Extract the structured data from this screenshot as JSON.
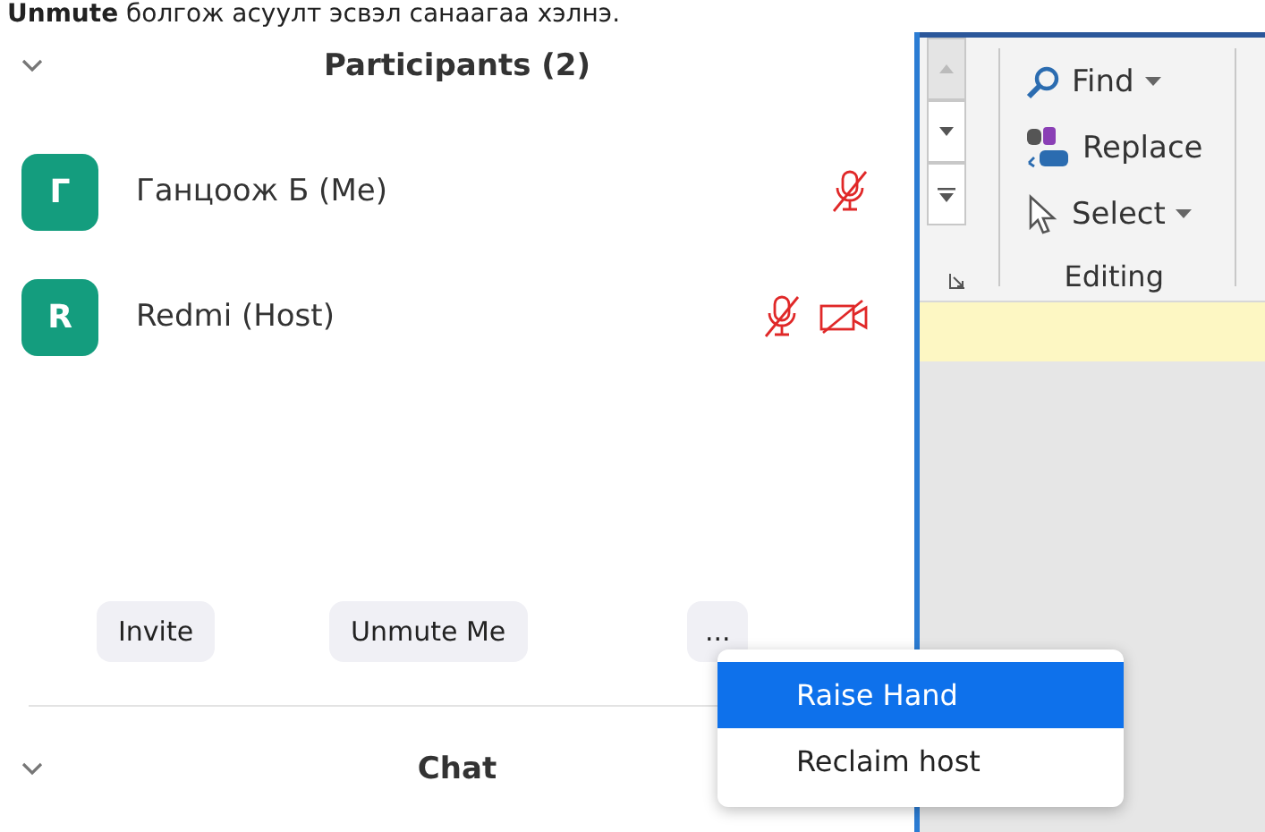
{
  "top_text": "**Unmute** болгож асуулт эсвэл санаагаа хэлнэ.",
  "participants": {
    "title": "Participants (2)",
    "members": [
      {
        "initial": "Г",
        "name": "Ганцоож Б (Me)",
        "mic_muted": true,
        "video_off": false
      },
      {
        "initial": "R",
        "name": "Redmi (Host)",
        "mic_muted": true,
        "video_off": true
      }
    ]
  },
  "buttons": [
    {
      "kind": "invite",
      "label": "Invite"
    },
    {
      "kind": "unmute",
      "label": "Unmute Me"
    },
    {
      "kind": "more",
      "label": "..."
    }
  ],
  "more_menu": {
    "items": [
      {
        "label": "Raise Hand",
        "selected": true
      },
      {
        "label": "Reclaim host",
        "selected": false
      }
    ]
  },
  "chat": {
    "title": "Chat"
  },
  "ribbon": {
    "commands": [
      {
        "kind": "find",
        "label": "Find",
        "dropdown": true
      },
      {
        "kind": "replace",
        "label": "Replace",
        "dropdown": false
      },
      {
        "kind": "select",
        "label": "Select",
        "dropdown": true
      }
    ],
    "group_label": "Editing"
  }
}
